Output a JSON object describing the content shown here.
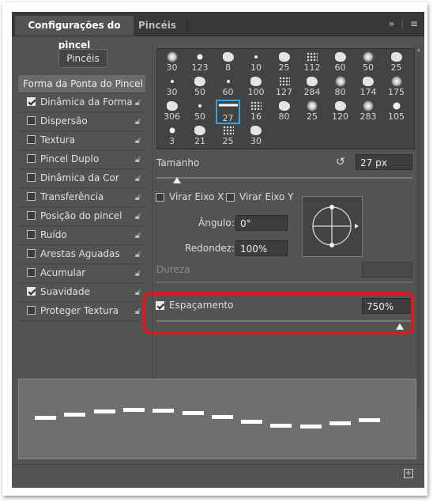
{
  "tabs": {
    "active": "Configurações do pincel",
    "other": "Pincéis"
  },
  "tabbar_icons": {
    "collapse": "»",
    "menu": "≡"
  },
  "brushes_button": "Pincéis",
  "sidebar": {
    "header": "Forma da Ponta do Pincel",
    "items": [
      {
        "label": "Dinâmica da Forma",
        "checked": true
      },
      {
        "label": "Dispersão",
        "checked": false
      },
      {
        "label": "Textura",
        "checked": false
      },
      {
        "label": "Pincel Duplo",
        "checked": false
      },
      {
        "label": "Dinâmica da Cor",
        "checked": false
      },
      {
        "label": "Transferência",
        "checked": false
      },
      {
        "label": "Posição do pincel",
        "checked": false
      },
      {
        "label": "Ruído",
        "checked": false
      },
      {
        "label": "Arestas Aguadas",
        "checked": false
      },
      {
        "label": "Acumular",
        "checked": false
      },
      {
        "label": "Suavidade",
        "checked": true
      },
      {
        "label": "Proteger Textura",
        "checked": false
      }
    ]
  },
  "brush_grid": {
    "rows": [
      [
        "30",
        "123",
        "8",
        "10",
        "25",
        "112",
        "60",
        "50",
        "25"
      ],
      [
        "30",
        "50",
        "60",
        "100",
        "127",
        "284",
        "80",
        "174",
        "175"
      ],
      [
        "306",
        "50",
        "27",
        "16",
        "80",
        "25",
        "120",
        "283",
        "105"
      ],
      [
        "3",
        "21",
        "25",
        "30"
      ]
    ],
    "selected": "27"
  },
  "size": {
    "label": "Tamanho",
    "value": "27 px",
    "level": 0.08
  },
  "flip": {
    "x_label": "Virar Eixo X",
    "y_label": "Virar Eixo Y"
  },
  "angle": {
    "label": "Ângulo:",
    "value": "0°"
  },
  "roundness": {
    "label": "Redondez:",
    "value": "100%"
  },
  "hardness": {
    "label": "Dureza"
  },
  "spacing": {
    "label": "Espaçamento",
    "value": "750%",
    "checked": true,
    "level": 0.95
  },
  "colors": {
    "panel": "#535353",
    "highlight": "#d71920",
    "selection": "#3aa0dc"
  }
}
